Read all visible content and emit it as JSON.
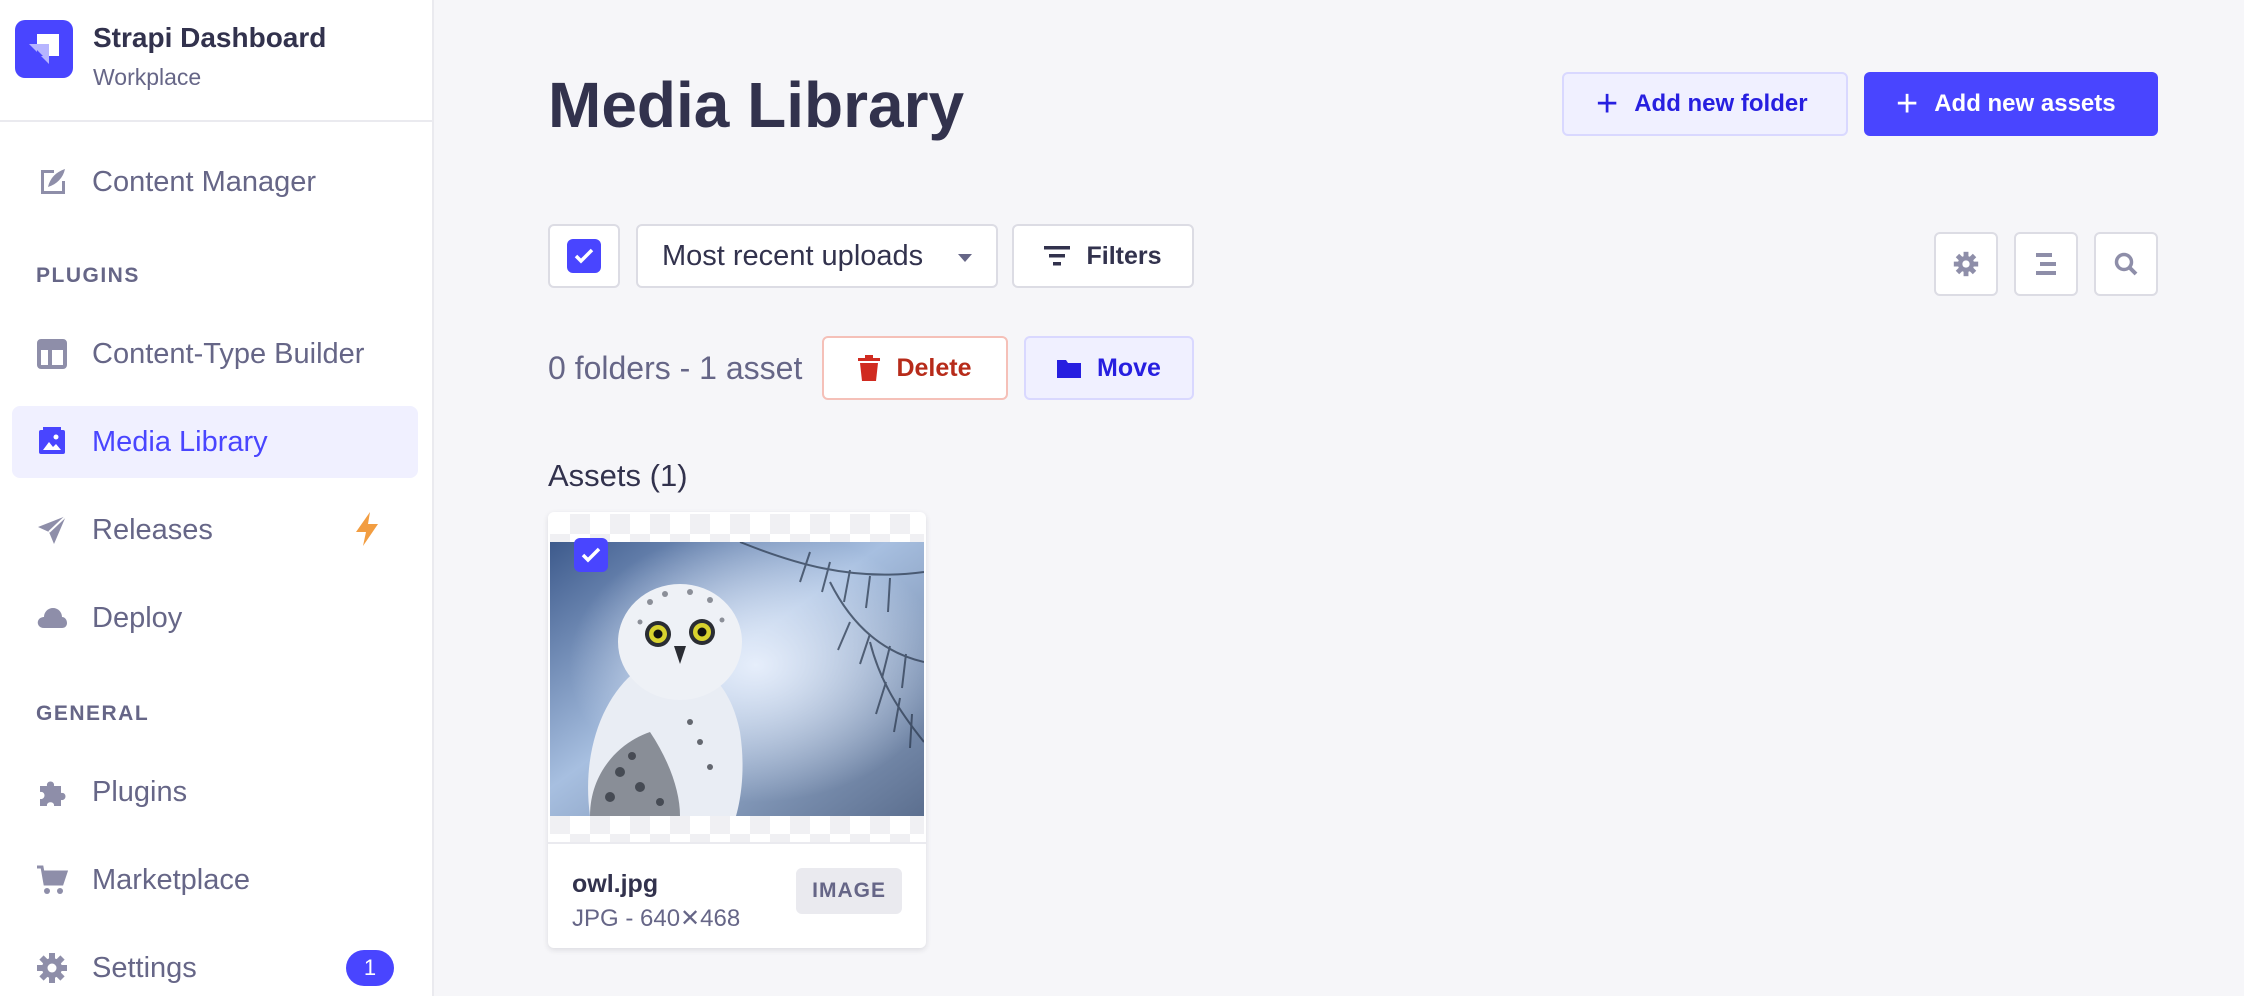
{
  "brand": {
    "title": "Strapi Dashboard",
    "subtitle": "Workplace"
  },
  "sidebar": {
    "items": [
      {
        "label": "Content Manager",
        "icon": "feather-icon"
      },
      {
        "label": "Content-Type Builder",
        "icon": "layout-icon"
      },
      {
        "label": "Media Library",
        "icon": "image-icon",
        "active": true
      },
      {
        "label": "Releases",
        "icon": "paper-plane-icon",
        "trailing_icon": "lightning-icon"
      },
      {
        "label": "Deploy",
        "icon": "cloud-icon"
      },
      {
        "label": "Plugins",
        "icon": "puzzle-icon"
      },
      {
        "label": "Marketplace",
        "icon": "cart-icon"
      },
      {
        "label": "Settings",
        "icon": "gear-icon",
        "badge": "1"
      }
    ],
    "sections": {
      "plugins": "PLUGINS",
      "general": "GENERAL"
    }
  },
  "header": {
    "title": "Media Library",
    "add_folder_label": "Add new folder",
    "add_assets_label": "Add new assets"
  },
  "toolbar": {
    "sort_value": "Most recent uploads",
    "filters_label": "Filters",
    "select_all_checked": true
  },
  "selection": {
    "count_text": "0 folders - 1 asset",
    "delete_label": "Delete",
    "move_label": "Move"
  },
  "assets": {
    "heading": "Assets (1)",
    "items": [
      {
        "name": "owl.jpg",
        "meta": "JPG - 640✕468",
        "type": "IMAGE",
        "checked": true
      }
    ]
  },
  "colors": {
    "primary": "#4945ff",
    "danger": "#b72b1a",
    "text": "#32324d",
    "muted": "#666687",
    "background": "#f6f6f9"
  }
}
